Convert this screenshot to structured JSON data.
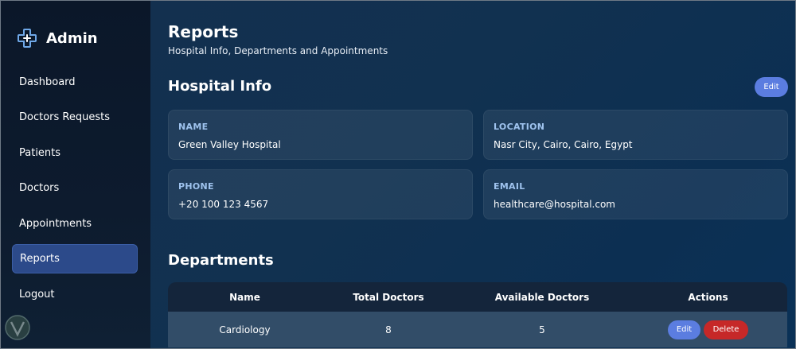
{
  "sidebar": {
    "brand_title": "Admin",
    "brand_icon": "medical-cross-icon",
    "items": [
      {
        "label": "Dashboard",
        "active": false
      },
      {
        "label": "Doctors Requests",
        "active": false
      },
      {
        "label": "Patients",
        "active": false
      },
      {
        "label": "Doctors",
        "active": false
      },
      {
        "label": "Appointments",
        "active": false
      },
      {
        "label": "Reports",
        "active": true
      },
      {
        "label": "Logout",
        "active": false
      }
    ]
  },
  "header": {
    "title": "Reports",
    "subtitle": "Hospital Info, Departments and Appointments"
  },
  "hospital_info": {
    "title": "Hospital Info",
    "edit_label": "Edit",
    "fields": [
      {
        "label": "NAME",
        "value": "Green Valley Hospital"
      },
      {
        "label": "LOCATION",
        "value": "Nasr City, Cairo, Cairo, Egypt"
      },
      {
        "label": "PHONE",
        "value": "+20 100 123 4567"
      },
      {
        "label": "EMAIL",
        "value": "healthcare@hospital.com"
      }
    ]
  },
  "departments": {
    "title": "Departments",
    "columns": [
      "Name",
      "Total Doctors",
      "Available Doctors",
      "Actions"
    ],
    "rows": [
      {
        "name": "Cardiology",
        "total_doctors": "8",
        "available_doctors": "5",
        "edit_label": "Edit",
        "delete_label": "Delete"
      }
    ]
  },
  "colors": {
    "accent": "#5b7de0",
    "danger": "#c62828",
    "active_nav": "#2c4a8a",
    "label": "#9fc3ee"
  }
}
